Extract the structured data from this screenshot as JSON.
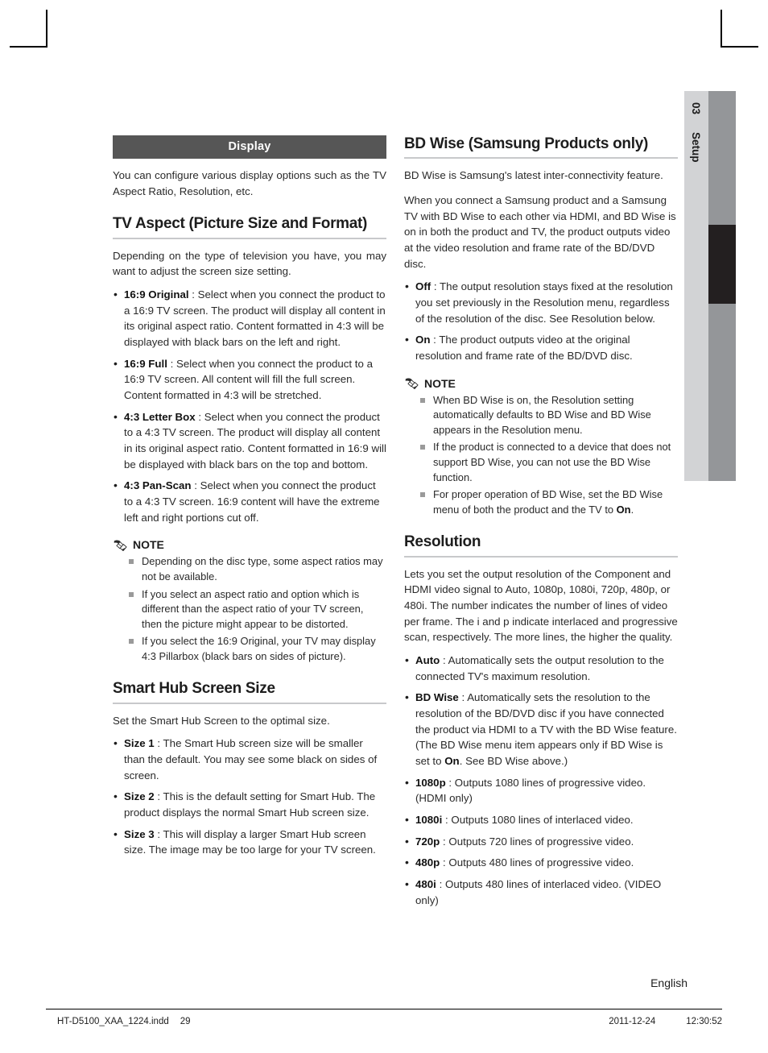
{
  "side_tab": {
    "chapter_number": "03",
    "chapter_name": "Setup",
    "label_bg": "#d2d3d5",
    "bar_bg": "#949699",
    "marker_bg": "#231f20"
  },
  "section_bar": {
    "title": "Display",
    "bg": "#565656",
    "color": "#ffffff"
  },
  "left_column": {
    "intro": "You can configure various display options such as the TV Aspect Ratio, Resolution, etc.",
    "tv_aspect": {
      "heading": "TV Aspect (Picture Size and Format)",
      "intro": "Depending on the type of television you have, you may want to adjust the screen size setting.",
      "items": [
        {
          "term": "16:9 Original",
          "sep": " : ",
          "text": "Select when you connect the product to a 16:9 TV screen. The product will display all content in its original aspect ratio. Content formatted in 4:3 will be displayed with black bars on the left and right."
        },
        {
          "term": "16:9 Full",
          "sep": " : ",
          "text": "Select when you connect the product to a 16:9 TV screen. All content will fill the full screen. Content formatted in 4:3 will be stretched."
        },
        {
          "term": "4:3 Letter Box",
          "sep": " : ",
          "text": "Select when you connect the product to a 4:3 TV screen. The product will display all content in its original aspect ratio. Content formatted in 16:9 will be displayed with black bars on the top and bottom."
        },
        {
          "term": "4:3 Pan-Scan",
          "sep": " : ",
          "text": "Select when you connect the product to a 4:3 TV screen. 16:9 content will have the extreme left and right portions cut off."
        }
      ]
    },
    "note": {
      "label": "NOTE",
      "icon": "pencil-icon",
      "items": [
        "Depending on the disc type, some aspect ratios may not be available.",
        "If you select an aspect ratio and option which is different than the aspect ratio of your TV screen, then the picture might appear to be distorted.",
        "If you select the 16:9 Original, your TV may display 4:3 Pillarbox (black bars on sides of picture)."
      ]
    },
    "smart_hub": {
      "heading": "Smart Hub Screen Size",
      "intro": "Set the Smart Hub Screen to the optimal size.",
      "items": [
        {
          "term": "Size 1",
          "sep": " : ",
          "text": "The Smart Hub screen size will be smaller than the default. You may see some black on sides of screen."
        },
        {
          "term": "Size 2",
          "sep": " : ",
          "text": "This is the default setting for Smart Hub. The product displays the normal Smart Hub screen size."
        },
        {
          "term": "Size 3",
          "sep": " : ",
          "text": "This will display a larger Smart Hub screen size. The image may be too large for your TV screen."
        }
      ]
    }
  },
  "right_column": {
    "bd_wise": {
      "heading": "BD Wise (Samsung Products only)",
      "para1": "BD Wise is Samsung's latest inter-connectivity feature.",
      "para2": "When you connect a Samsung product and a Samsung TV with BD Wise to each other via HDMI, and BD Wise is on in both the product and TV, the product outputs video at the video resolution and frame rate of the BD/DVD disc.",
      "items": [
        {
          "term": "Off",
          "sep": " : ",
          "text": "The output resolution stays fixed at the resolution you set previously in the Resolution menu, regardless of the resolution of the disc. See Resolution below."
        },
        {
          "term": "On",
          "sep": " : ",
          "text": "The product outputs video at the original resolution and frame rate of the BD/DVD disc."
        }
      ]
    },
    "note": {
      "label": "NOTE",
      "icon": "pencil-icon",
      "items": [
        {
          "text": "When BD Wise is on, the Resolution setting automatically defaults to BD Wise and BD Wise appears in the Resolution menu."
        },
        {
          "text": "If the product is connected to a device that does not support BD Wise, you can not use the BD Wise function."
        },
        {
          "text_before": "For proper operation of BD Wise, set the BD Wise menu of both the product and the TV to ",
          "bold": "On",
          "text_after": "."
        }
      ]
    },
    "resolution": {
      "heading": "Resolution",
      "intro": "Lets you set the output resolution of the Component and HDMI video signal to Auto, 1080p, 1080i, 720p, 480p, or 480i. The number indicates the number of lines of video per frame. The i and p indicate interlaced and progressive scan, respectively. The more lines, the higher the quality.",
      "items": [
        {
          "term": "Auto",
          "sep": " : ",
          "text": "Automatically sets the output resolution to the connected TV's maximum resolution."
        },
        {
          "term": "BD Wise",
          "sep": " : ",
          "text_before": "Automatically sets the resolution to the resolution of the BD/DVD disc if you have connected the product via HDMI to a TV with the BD Wise feature. (The BD Wise menu item appears only if BD Wise is set to ",
          "bold": "On",
          "text_after": ". See BD Wise above.)"
        },
        {
          "term": "1080p",
          "sep": " : ",
          "text": "Outputs 1080 lines of progressive video. (HDMI only)"
        },
        {
          "term": "1080i",
          "sep": " : ",
          "text": "Outputs 1080 lines of interlaced video."
        },
        {
          "term": "720p",
          "sep": " : ",
          "text": "Outputs 720 lines of progressive video."
        },
        {
          "term": "480p",
          "sep": " : ",
          "text": "Outputs 480 lines of progressive video."
        },
        {
          "term": "480i",
          "sep": " : ",
          "text": "Outputs 480 lines of interlaced video. (VIDEO only)"
        }
      ]
    }
  },
  "language_label": "English",
  "footer": {
    "file_name": "HT-D5100_XAA_1224.indd",
    "page_number": "29",
    "date": "2011-12-24",
    "time": "12:30:52"
  }
}
